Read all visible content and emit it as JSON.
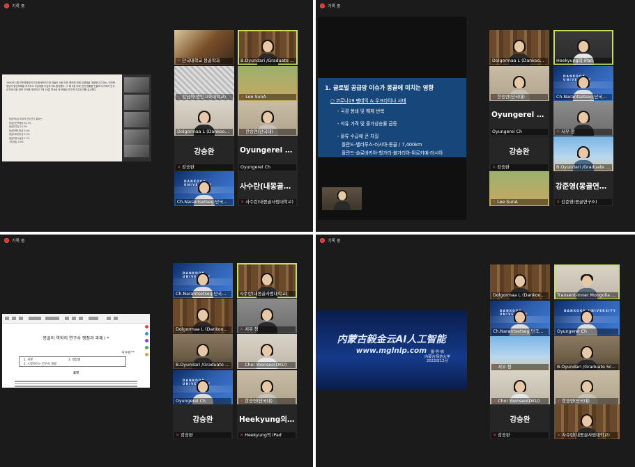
{
  "recording_label": "기록 중",
  "q1": {
    "slide": {
      "paragraph": "1960년 1월 인민혁명당의 민주화세력의 지도자들이 사회 인민 협의에 의해 임명법을 개정했다고 하는, 인민혁명당의 발전목록을 포기하고 다당제를 도입하기로 합의했다. 그 해 4월 이래 관련 법률을 만들며 추가하여 민주선거에 대한 법적 근거를 마련하고 7월 28일 역사상 첫 번째로 민주적 자유선거를 실시했다.",
      "list_title": "몽골역사상 최초의 민주선거 결과는:",
      "list": [
        "몽골인민혁명당 61.7%",
        "몽골민주당 24.3%",
        "몽골민족진보당 5.9%",
        "몽골사회민주당 5.5%",
        "몽골자유노동당 1.7%",
        "기타정당 0.9%"
      ]
    },
    "tiles": [
      {
        "name": "단국대학교 몽골학과",
        "big": ""
      },
      {
        "name": "B.Oyundari /Graduate School...",
        "big": ""
      },
      {
        "name": "강남욱(명인고육대학교)",
        "big": ""
      },
      {
        "name": "Lee SunA",
        "big": ""
      },
      {
        "name": "Dolgormaa L (Dankook U...",
        "big": ""
      },
      {
        "name": "한승연(단국대)",
        "big": ""
      },
      {
        "name": "강승완",
        "big": "강승완"
      },
      {
        "name": "Oyungerel Ch",
        "big": "Oyungerel Ch"
      },
      {
        "name": "Ch.Narantsetseg 단국대...",
        "big": ""
      },
      {
        "name": "사수란(내몽골사범대학교)",
        "big": "사수란(내몽골사..."
      }
    ]
  },
  "q2": {
    "slide": {
      "heading": "1. 글로벌 공급망 이슈가 몽골에 미치는 영향",
      "bullet1": "○ 코로나19 팬데믹 & 우크라이나 사태",
      "lines": [
        "- 국경 봉쇄 및 해제 반복",
        "- 석유 가격 및 물가상승률 급등",
        "- 물류 수급에 큰 차질"
      ],
      "routes": [
        "폴란드-벨라루스-러시아-몽골 / 7,400km",
        "폴란드-슬로바키아-헝가리-불가리아-튀르키예-러시아"
      ]
    },
    "tiles": [
      {
        "name": "Dolgormaa L (Dankook U...",
        "big": ""
      },
      {
        "name": "Heekyung의 iPad",
        "big": ""
      },
      {
        "name": "한승연(단국대)",
        "big": ""
      },
      {
        "name": "Ch.Narantsetseg 단국대...",
        "big": ""
      },
      {
        "name": "Oyungerel Ch",
        "big": "Oyungerel Ch"
      },
      {
        "name": "서우 청",
        "big": ""
      },
      {
        "name": "강승완",
        "big": "강승완"
      },
      {
        "name": "B.Oyundari /Graduate Sc...",
        "big": ""
      },
      {
        "name": "Lee SunA",
        "big": ""
      },
      {
        "name": "강준영(몽골연구소)",
        "big": "강준영(몽골연구..."
      }
    ]
  },
  "q3": {
    "doc": {
      "title": "몽골어 역학의 연구사 쟁점과 과제 I *",
      "author": "사수란**",
      "toc": [
        "1. 서론",
        "3. 쟁점별",
        "2. <몽학어> 연구사 개괄"
      ],
      "abstract_head": "요약"
    },
    "tiles": [
      {
        "name": "Ch.Narantsetseg 단국대...",
        "big": ""
      },
      {
        "name": "사수란(내몽골사범대학교)",
        "big": ""
      },
      {
        "name": "Dolgormaa L (Dankook U...",
        "big": ""
      },
      {
        "name": "서우 청",
        "big": ""
      },
      {
        "name": "B.Oyundari /Graduate Sc...",
        "big": ""
      },
      {
        "name": "Choi Yoonseo(DKU)",
        "big": ""
      },
      {
        "name": "Oyungerel Ch",
        "big": ""
      },
      {
        "name": "한승연(단국대)",
        "big": ""
      },
      {
        "name": "강승완",
        "big": "강승완"
      },
      {
        "name": "Heekyung의 iPad",
        "big": "Heekyung의 iPad"
      }
    ]
  },
  "q4": {
    "banner": {
      "title": "内蒙古毅金云AI人工智能",
      "url": "www.mglnlp.com",
      "org_line1": "图·导·统",
      "org_line2": "内蒙古师范大学",
      "org_line3": "2022年12月"
    },
    "tiles": [
      {
        "name": "Dolgormaa L (Dankook U...",
        "big": ""
      },
      {
        "name": "Transent-Inner Mongolia Nor...",
        "big": ""
      },
      {
        "name": "Ch.Narantsetseg 단국대...",
        "big": ""
      },
      {
        "name": "Oyungerel Ch",
        "big": ""
      },
      {
        "name": "서우 청",
        "big": ""
      },
      {
        "name": "B.Oyundari /Graduate Sc...",
        "big": ""
      },
      {
        "name": "Choi Yoonseo(DKU)",
        "big": ""
      },
      {
        "name": "한승연(단국대)",
        "big": ""
      },
      {
        "name": "강승완",
        "big": "강승완"
      },
      {
        "name": "사수란(내몽골사범대학교)",
        "big": ""
      }
    ]
  },
  "dku_text": "DANKOOK UNIVERSITY"
}
